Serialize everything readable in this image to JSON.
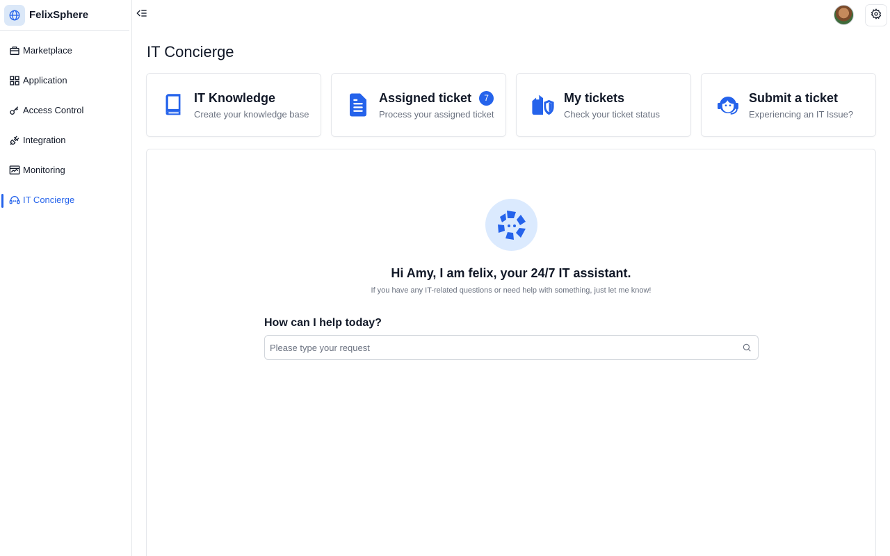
{
  "app": {
    "name": "FelixSphere",
    "logo_icon": "globe-icon"
  },
  "sidebar": {
    "items": [
      {
        "label": "Marketplace",
        "icon": "briefcase-icon",
        "active": false
      },
      {
        "label": "Application",
        "icon": "grid-icon",
        "active": false
      },
      {
        "label": "Access Control",
        "icon": "key-icon",
        "active": false
      },
      {
        "label": "Integration",
        "icon": "plug-icon",
        "active": false
      },
      {
        "label": "Monitoring",
        "icon": "monitor-chart-icon",
        "active": false
      },
      {
        "label": "IT Concierge",
        "icon": "headset-icon",
        "active": true
      }
    ]
  },
  "header": {
    "collapse_icon": "collapse-sidebar-icon",
    "settings_icon": "gear-icon"
  },
  "page": {
    "title": "IT Concierge"
  },
  "cards": [
    {
      "title": "IT Knowledge",
      "subtitle": "Create your knowledge base",
      "icon": "book-icon"
    },
    {
      "title": "Assigned ticket",
      "subtitle": "Process your assigned ticket",
      "icon": "document-icon",
      "badge": "7"
    },
    {
      "title": "My tickets",
      "subtitle": "Check your ticket status",
      "icon": "shield-ticket-icon"
    },
    {
      "title": "Submit a ticket",
      "subtitle": "Experiencing an IT Issue?",
      "icon": "support-agent-icon"
    }
  ],
  "assistant": {
    "greeting": "Hi Amy, I am felix, your 24/7 IT assistant.",
    "subtext": "If you have any IT-related questions or need help with something, just let me know!",
    "help_label": "How can I help today?",
    "search_placeholder": "Please type your request",
    "search_value": ""
  },
  "colors": {
    "accent": "#2563eb",
    "accent_light": "#dbeafe",
    "text": "#111827",
    "muted": "#6b7280",
    "border": "#e5e7eb"
  }
}
